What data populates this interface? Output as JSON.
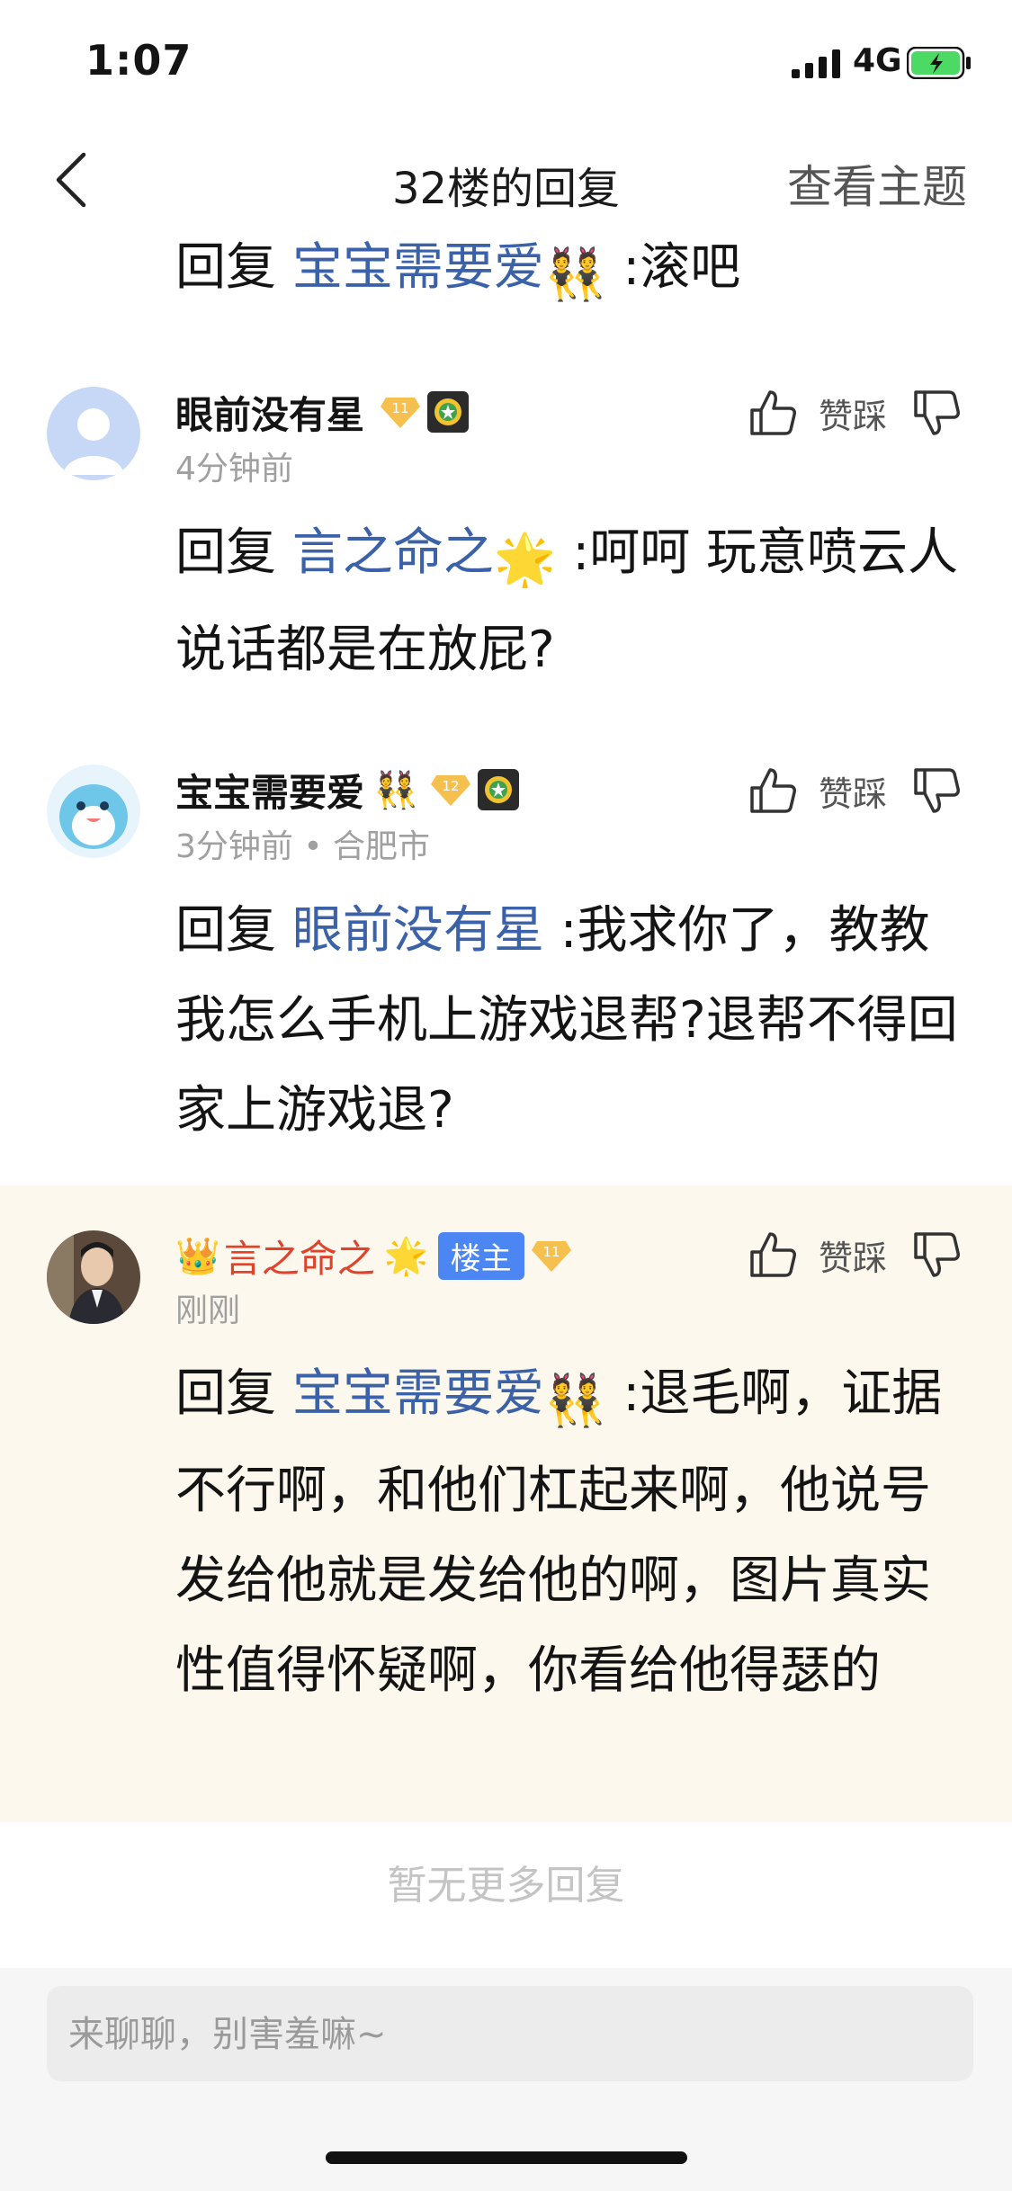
{
  "status_bar": {
    "time": "1:07",
    "network": "4G"
  },
  "nav": {
    "title": "32楼的回复",
    "action": "查看主题"
  },
  "partial_post": {
    "prefix": "回复 ",
    "target": "宝宝需要爱",
    "emoji": "👯",
    "text": " :滚吧"
  },
  "comments": [
    {
      "username": "眼前没有星",
      "level": "11",
      "time": "4分钟前",
      "location": "",
      "reply_prefix": "回复 ",
      "reply_target": "言之命之",
      "target_emoji": "🌟",
      "text": " :呵呵 玩意喷云人说话都是在放屁?",
      "vote_label": "赞踩"
    },
    {
      "username": "宝宝需要爱",
      "name_emoji": "👯",
      "level": "12",
      "time": "3分钟前",
      "location": "• 合肥市",
      "reply_prefix": "回复 ",
      "reply_target": "眼前没有星",
      "text": " :我求你了，教教我怎么手机上游戏退帮?退帮不得回家上游戏退?",
      "vote_label": "赞踩"
    },
    {
      "username": "言之命之",
      "name_prefix_emoji": "👑",
      "name_emoji": "🌟",
      "owner_tag": "楼主",
      "level": "11",
      "time": "刚刚",
      "reply_prefix": "回复 ",
      "reply_target": "宝宝需要爱",
      "target_emoji": "👯",
      "text": " :退毛啊，证据不行啊，和他们杠起来啊，他说号发给他就是发给他的啊，图片真实性值得怀疑啊，你看给他得瑟的",
      "vote_label": "赞踩"
    }
  ],
  "footer": {
    "no_more": "暂无更多回复",
    "input_placeholder": "来聊聊，别害羞嘛~"
  },
  "colors": {
    "link": "#3b62a8",
    "author_name": "#e0432c",
    "owner_tag_bg": "#4b86f3",
    "highlight_bg": "#fcf8ed"
  }
}
